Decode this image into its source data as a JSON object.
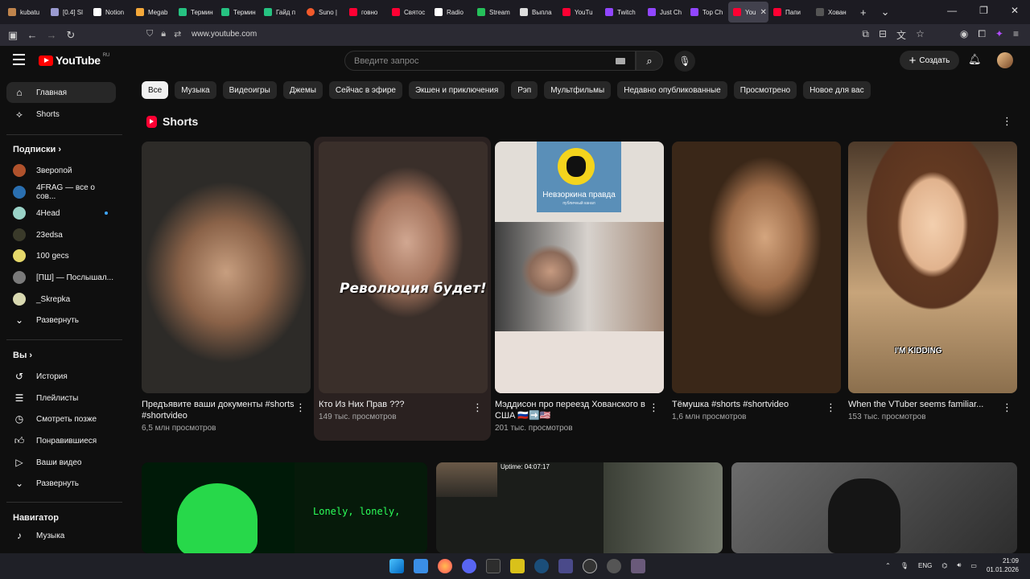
{
  "browser": {
    "tabs": [
      {
        "label": "kubatu",
        "color": "#c0844c"
      },
      {
        "label": "[0.4] Sl",
        "color": "#9a9ad0"
      },
      {
        "label": "Notion",
        "color": "#ffffff"
      },
      {
        "label": "Megab",
        "color": "#f4a83a"
      },
      {
        "label": "Термин",
        "color": "#26c281"
      },
      {
        "label": "Термин",
        "color": "#26c281"
      },
      {
        "label": "Гайд п",
        "color": "#26c281"
      },
      {
        "label": "Suno |",
        "color": "#f25a2b"
      },
      {
        "label": "говно",
        "color": "#ff0033"
      },
      {
        "label": "Святос",
        "color": "#ff0033"
      },
      {
        "label": "Radio",
        "color": "#ffffff"
      },
      {
        "label": "Stream",
        "color": "#25c05a"
      },
      {
        "label": "Выпла",
        "color": "#dddddd"
      },
      {
        "label": "YouTu",
        "color": "#ff0033"
      },
      {
        "label": "Twitch",
        "color": "#9146ff"
      },
      {
        "label": "Just Ch",
        "color": "#9146ff"
      },
      {
        "label": "Top Ch",
        "color": "#9146ff"
      },
      {
        "label": "You",
        "color": "#ff0033",
        "active": true
      },
      {
        "label": "Папи",
        "color": "#ff0033"
      },
      {
        "label": "Хован",
        "color": "#555555"
      }
    ],
    "url": "www.youtube.com"
  },
  "youtube": {
    "logo_text": "YouTube",
    "region": "RU",
    "search_placeholder": "Введите запрос",
    "create_label": "Создать"
  },
  "sidebar": {
    "main": [
      {
        "label": "Главная",
        "icon": "home-icon",
        "active": true
      },
      {
        "label": "Shorts",
        "icon": "shorts-icon"
      }
    ],
    "subscriptions_title": "Подписки",
    "subscriptions": [
      {
        "label": "Зверопой",
        "color": "#b0522c"
      },
      {
        "label": "4FRAG — все о сов...",
        "color": "#2a6fb0"
      },
      {
        "label": "4Head",
        "color": "#9ad2c7",
        "live_dot": true
      },
      {
        "label": "23edsa",
        "color": "#3a3a2a"
      },
      {
        "label": "100 gecs",
        "color": "#e5d86a"
      },
      {
        "label": "[ПШ] — Послышал...",
        "color": "#7a7a7a"
      },
      {
        "label": "_Skrepka",
        "color": "#d8d8b0"
      },
      {
        "label": "Развернуть",
        "icon": "chevron-down-icon"
      }
    ],
    "you_title": "Вы",
    "you": [
      {
        "label": "История",
        "icon": "history-icon"
      },
      {
        "label": "Плейлисты",
        "icon": "playlists-icon"
      },
      {
        "label": "Смотреть позже",
        "icon": "watch-later-icon"
      },
      {
        "label": "Понравившиеся",
        "icon": "like-icon"
      },
      {
        "label": "Ваши видео",
        "icon": "your-videos-icon"
      },
      {
        "label": "Развернуть",
        "icon": "chevron-down-icon"
      }
    ],
    "navigator_title": "Навигатор",
    "navigator": [
      {
        "label": "Музыка",
        "icon": "music-icon"
      }
    ]
  },
  "chips": [
    "Все",
    "Музыка",
    "Видеоигры",
    "Джемы",
    "Сейчас в эфире",
    "Экшен и приключения",
    "Рэп",
    "Мультфильмы",
    "Недавно опубликованные",
    "Просмотрено",
    "Новое для вас"
  ],
  "shorts": {
    "title": "Shorts",
    "items": [
      {
        "title": "Предъявите ваши документы #shorts  #shortvideo",
        "views": "6,5 млн просмотров"
      },
      {
        "title": "Кто Из Них Прав ???",
        "views": "149 тыс. просмотров",
        "caption": "Революция будет!"
      },
      {
        "title": "Мэддисон про переезд Хованского в США 🇷🇺➡️🇺🇸",
        "views": "201 тыс. просмотров",
        "channel_name": "Невзоркина правда",
        "channel_sub": "публичный канал"
      },
      {
        "title": "Тёмушка #shorts  #shortvideo",
        "views": "1,6 млн просмотров"
      },
      {
        "title": "When the VTuber seems familiar...",
        "views": "153 тыс. просмотров",
        "caption": "I'M KIDDING"
      }
    ]
  },
  "videos": {
    "v1_text": "Lonely, lonely,",
    "v2_uptime": "Uptime: 04:07:17"
  },
  "taskbar": {
    "lang": "ENG",
    "time": "21:09",
    "date": "01.01.2026"
  }
}
